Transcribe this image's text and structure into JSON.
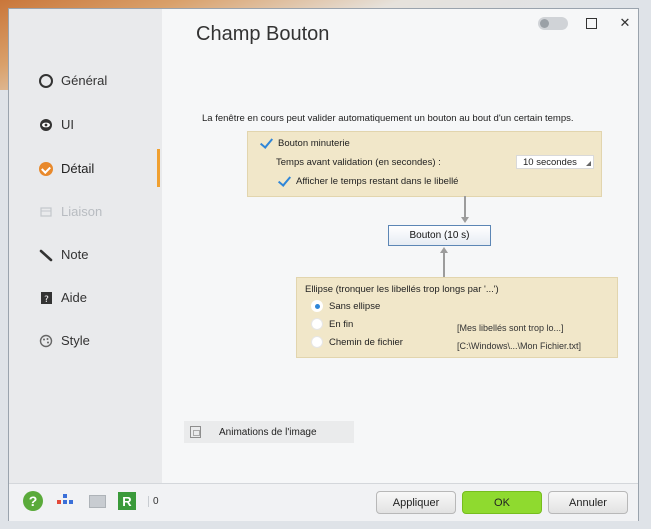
{
  "window": {
    "title": "Champ Bouton"
  },
  "sidebar": {
    "items": [
      {
        "label": "Général",
        "icon": "radio-ring-icon",
        "state": "normal"
      },
      {
        "label": "UI",
        "icon": "eye-icon",
        "state": "normal"
      },
      {
        "label": "Détail",
        "icon": "check-circle-icon",
        "state": "active"
      },
      {
        "label": "Liaison",
        "icon": "link-icon",
        "state": "disabled"
      },
      {
        "label": "Note",
        "icon": "pencil-icon",
        "state": "normal"
      },
      {
        "label": "Aide",
        "icon": "help-book-icon",
        "state": "normal"
      },
      {
        "label": "Style",
        "icon": "palette-icon",
        "state": "normal"
      }
    ],
    "accent_color": "#e8892c"
  },
  "main": {
    "description": "La fenêtre en cours peut valider automatiquement un bouton au bout d'un certain temps.",
    "timer": {
      "checkbox_label": "Bouton minuterie",
      "checked": true,
      "delay_label": "Temps avant validation (en secondes) :",
      "delay_value": "10 secondes",
      "show_remaining_label": "Afficher le temps restant dans le libellé",
      "show_remaining_checked": true
    },
    "preview_button": {
      "label": "Bouton   (10 s)"
    },
    "ellipsis": {
      "heading": "Ellipse (tronquer les libellés trop longs par '...')",
      "options": [
        {
          "label": "Sans ellipse",
          "selected": true,
          "example": ""
        },
        {
          "label": "En fin",
          "selected": false,
          "example": "[Mes libellés sont trop lo...]"
        },
        {
          "label": "Chemin de fichier",
          "selected": false,
          "example": "[C:\\Windows\\...\\Mon Fichier.txt]"
        }
      ]
    },
    "animations_label": "Animations de l'image"
  },
  "bottom_bar": {
    "count": "0",
    "apply_label": "Appliquer",
    "ok_label": "OK",
    "cancel_label": "Annuler",
    "ok_color": "#8fda2f"
  }
}
